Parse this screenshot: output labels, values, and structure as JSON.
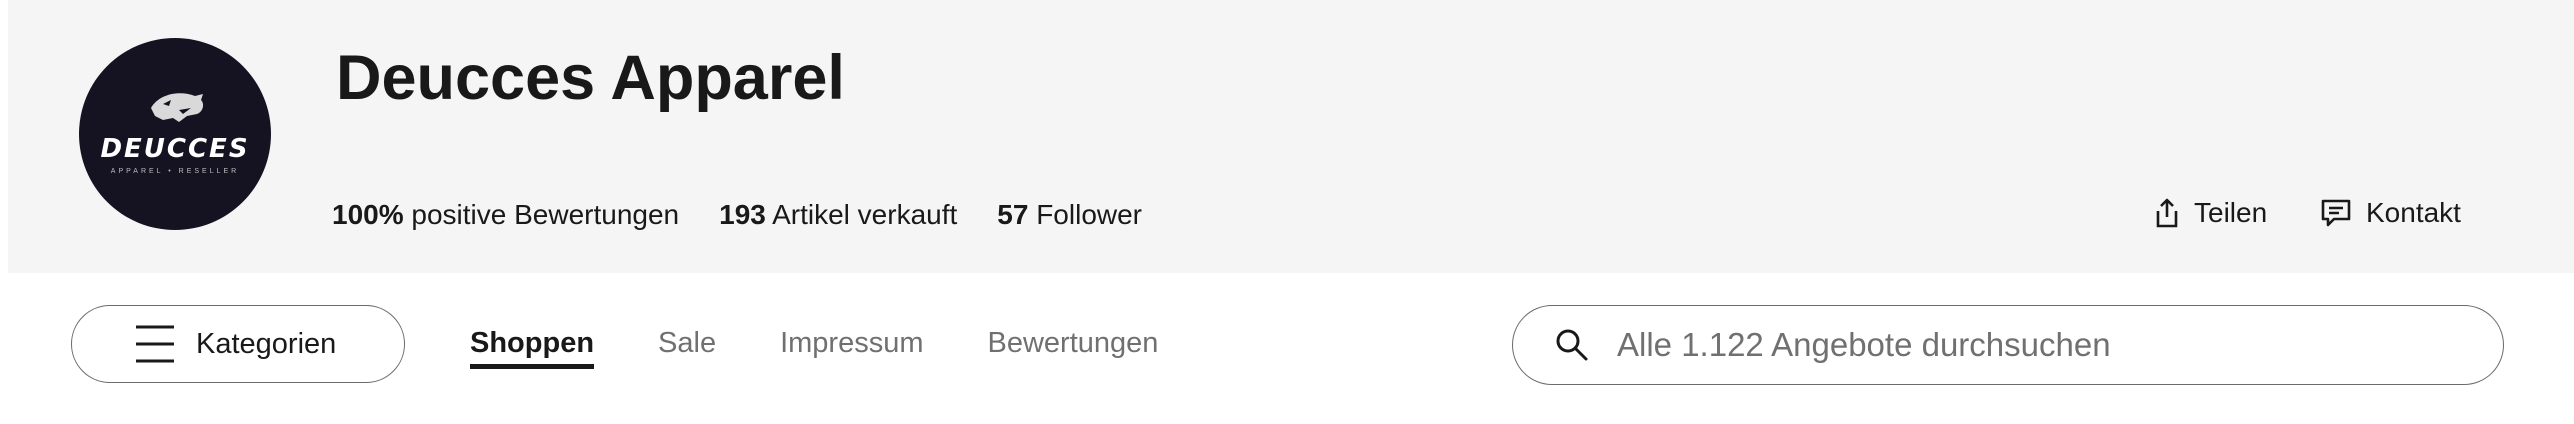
{
  "store": {
    "name": "Deucces Apparel",
    "logo": {
      "wordmark": "DEUCCES",
      "tagline": "APPAREL • RESELLER",
      "background_color": "#151321",
      "icon": "panther-head-icon"
    }
  },
  "stats": [
    {
      "value": "100%",
      "label": "positive Bewertungen"
    },
    {
      "value": "193",
      "label": "Artikel verkauft"
    },
    {
      "value": "57",
      "label": "Follower"
    }
  ],
  "actions": {
    "share": {
      "label": "Teilen",
      "icon": "share-icon"
    },
    "contact": {
      "label": "Kontakt",
      "icon": "chat-icon"
    }
  },
  "nav": {
    "categories_button": {
      "label": "Kategorien",
      "icon": "menu-icon"
    },
    "tabs": [
      {
        "label": "Shoppen",
        "active": true
      },
      {
        "label": "Sale",
        "active": false
      },
      {
        "label": "Impressum",
        "active": false
      },
      {
        "label": "Bewertungen",
        "active": false
      }
    ]
  },
  "search": {
    "placeholder": "Alle 1.122 Angebote durchsuchen",
    "value": "",
    "icon": "search-icon"
  },
  "colors": {
    "header_background": "#f5f5f5",
    "text_primary": "#191919",
    "text_secondary": "#707070",
    "border": "#6b6b6b"
  }
}
